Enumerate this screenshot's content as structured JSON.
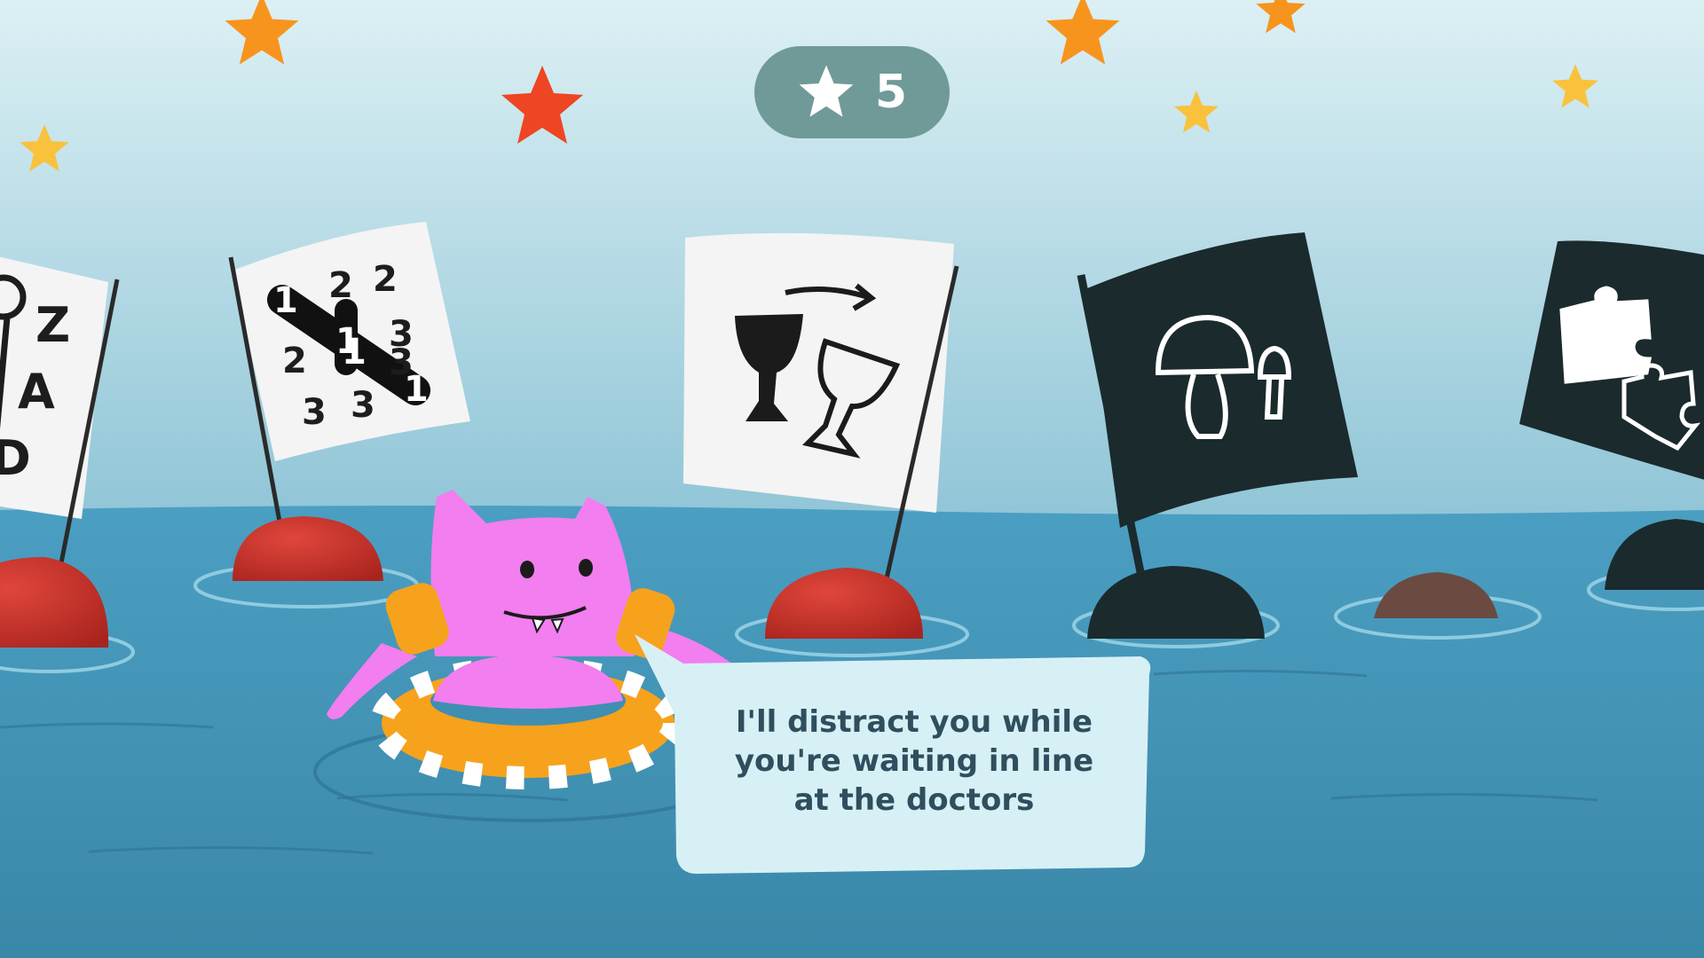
{
  "hud": {
    "star_count": "5",
    "star_icon": "star-icon",
    "pill_color": "#6f9a97"
  },
  "level_flags": [
    {
      "name": "word-search-flag",
      "icon": "letter-grid-icon",
      "glyphs": [
        "Z",
        "A",
        "D"
      ],
      "flag_color": "#f4f4f4",
      "buoy_color": "#c8342b"
    },
    {
      "name": "number-link-flag",
      "icon": "number-link-icon",
      "glyphs": [
        "1",
        "2",
        "2",
        "1",
        "3",
        "2",
        "1",
        "3",
        "3",
        "3",
        "1"
      ],
      "flag_color": "#f4f4f4",
      "buoy_color": "#c8342b"
    },
    {
      "name": "matching-glasses-flag",
      "icon": "glasses-arrow-icon",
      "flag_color": "#f4f4f4",
      "buoy_color": "#c8342b"
    },
    {
      "name": "mushroom-flag",
      "icon": "mushroom-icon",
      "flag_color": "#1b2a2d",
      "buoy_color": "#1b2a2d"
    },
    {
      "name": "puzzle-flag",
      "icon": "puzzle-piece-icon",
      "flag_color": "#1b2a2d",
      "buoy_color": "#1b2a2d"
    }
  ],
  "character": {
    "name": "pink-cat-monster",
    "body_color": "#f27ef0",
    "float_ring_colors": [
      "#f7a21c",
      "#ffffff"
    ]
  },
  "speech_bubble": {
    "text_lines": [
      "I'll distract you while",
      "you're waiting in line",
      "at the doctors"
    ]
  },
  "colors": {
    "sky_top": "#d9eef3",
    "sky_bottom": "#8ec2d4",
    "sea": "#3f8fb2",
    "star_orange": "#f7941d",
    "star_red": "#ee4523",
    "star_yellow": "#f9c23c"
  }
}
